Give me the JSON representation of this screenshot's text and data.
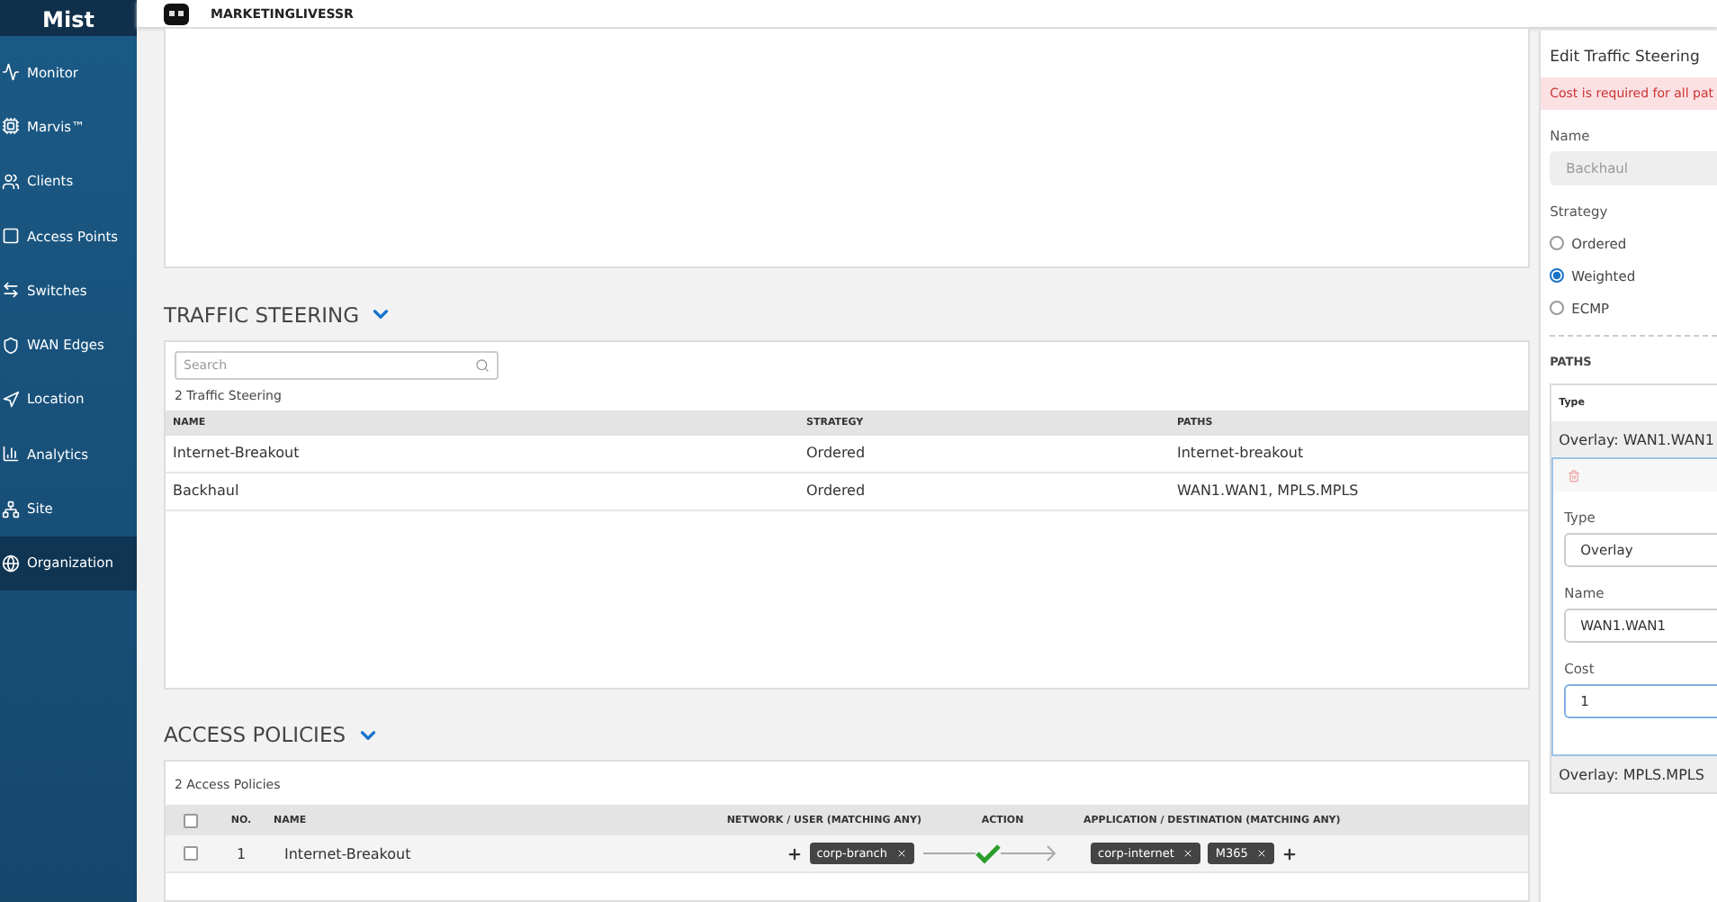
{
  "sidebar": {
    "logo": "Mist",
    "items": [
      {
        "label": "Monitor",
        "selected": false
      },
      {
        "label": "Marvis™",
        "selected": false
      },
      {
        "label": "Clients",
        "selected": false
      },
      {
        "label": "Access Points",
        "selected": false
      },
      {
        "label": "Switches",
        "selected": false
      },
      {
        "label": "WAN Edges",
        "selected": false
      },
      {
        "label": "Location",
        "selected": false
      },
      {
        "label": "Analytics",
        "selected": false
      },
      {
        "label": "Site",
        "selected": false
      },
      {
        "label": "Organization",
        "selected": true
      }
    ]
  },
  "header": {
    "org_name": "MARKETINGLIVESSR"
  },
  "traffic_steering": {
    "title": "TRAFFIC STEERING",
    "search": {
      "placeholder": "Search"
    },
    "count": "2 Traffic Steering",
    "columns": [
      "NAME",
      "STRATEGY",
      "PATHS"
    ],
    "rows": [
      [
        "Internet-Breakout",
        "Ordered",
        "Internet-breakout"
      ],
      [
        "Backhaul",
        "Ordered",
        "WAN1.WAN1, MPLS.MPLS"
      ]
    ]
  },
  "access_policies": {
    "title": "ACCESS POLICIES",
    "count": "2 Access Policies",
    "select_all_checked": false,
    "columns": [
      "NO.",
      "NAME",
      "NETWORK / USER (MATCHING ANY)",
      "ACTION",
      "APPLICATION / DESTINATION (MATCHING ANY)"
    ],
    "rows": [
      {
        "checked": false,
        "no": "1",
        "name": "Internet-Breakout",
        "networks": [
          "corp-branch"
        ],
        "destinations": [
          "corp-internet",
          "M365"
        ]
      }
    ]
  },
  "edit_panel": {
    "title": "Edit Traffic Steering",
    "error": "Cost is required for all pat",
    "name_label": "Name",
    "name_value": "Backhaul",
    "strategy_label": "Strategy",
    "strategies": [
      {
        "label": "Ordered",
        "selected": false
      },
      {
        "label": "Weighted",
        "selected": true
      },
      {
        "label": "ECMP",
        "selected": false
      }
    ],
    "paths_label": "PATHS",
    "type_column": "Type",
    "paths": [
      {
        "summary": "Overlay: WAN1.WAN1",
        "expanded": true,
        "type_label": "Type",
        "type_value": "Overlay",
        "name_label": "Name",
        "name_value": "WAN1.WAN1",
        "cost_label": "Cost",
        "cost_value": "1"
      },
      {
        "summary": "Overlay: MPLS.MPLS",
        "expanded": false
      }
    ]
  }
}
